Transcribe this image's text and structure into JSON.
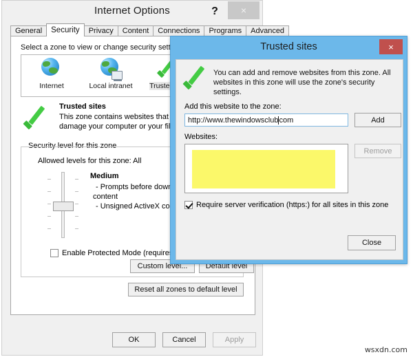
{
  "internet_options": {
    "title": "Internet Options",
    "help_label": "?",
    "close_label": "×",
    "tabs": [
      {
        "label": "General",
        "active": false
      },
      {
        "label": "Security",
        "active": true
      },
      {
        "label": "Privacy",
        "active": false
      },
      {
        "label": "Content",
        "active": false
      },
      {
        "label": "Connections",
        "active": false
      },
      {
        "label": "Programs",
        "active": false
      },
      {
        "label": "Advanced",
        "active": false
      }
    ],
    "zone_prompt": "Select a zone to view or change security setting",
    "zones": [
      {
        "label": "Internet",
        "icon": "globe-icon",
        "selected": false
      },
      {
        "label": "Local intranet",
        "icon": "globe-monitor-icon",
        "selected": false
      },
      {
        "label": "Trusted sites",
        "icon": "green-check-icon",
        "selected": true
      }
    ],
    "zone_description": {
      "title": "Trusted sites",
      "text": "This zone contains websites that you trust not to damage your computer or your files.",
      "icon": "green-check-icon"
    },
    "security_level": {
      "group_title": "Security level for this zone",
      "allowed_levels": "Allowed levels for this zone: All",
      "level_name": "Medium",
      "bullets": [
        "- Prompts before downloading p",
        "content",
        "- Unsigned ActiveX controls will"
      ]
    },
    "protected_mode": {
      "label": "Enable Protected Mode (requires restar",
      "checked": false
    },
    "buttons": {
      "custom_level": "Custom level...",
      "default_level": "Default level",
      "reset_all": "Reset all zones to default level",
      "ok": "OK",
      "cancel": "Cancel",
      "apply": "Apply",
      "apply_disabled": true
    }
  },
  "trusted_sites_dialog": {
    "title": "Trusted sites",
    "close_label": "×",
    "banner_text": "You can add and remove websites from this zone. All websites in this zone will use the zone's security settings.",
    "banner_icon": "green-check-icon",
    "add_label": "Add this website to the zone:",
    "url_value_before_caret": "http://www.thewindowsclub",
    "url_value_after_caret": "com",
    "add_button": "Add",
    "websites_label": "Websites:",
    "websites_items": [],
    "remove_button": "Remove",
    "remove_disabled": true,
    "require_verification": {
      "label": "Require server verification (https:) for all sites in this zone",
      "checked": true
    },
    "close_button": "Close",
    "highlight_color": "#fbf86a",
    "titlebar_color": "#6cb8ea",
    "close_color": "#c0504d"
  },
  "watermark": "wsxdn.com"
}
